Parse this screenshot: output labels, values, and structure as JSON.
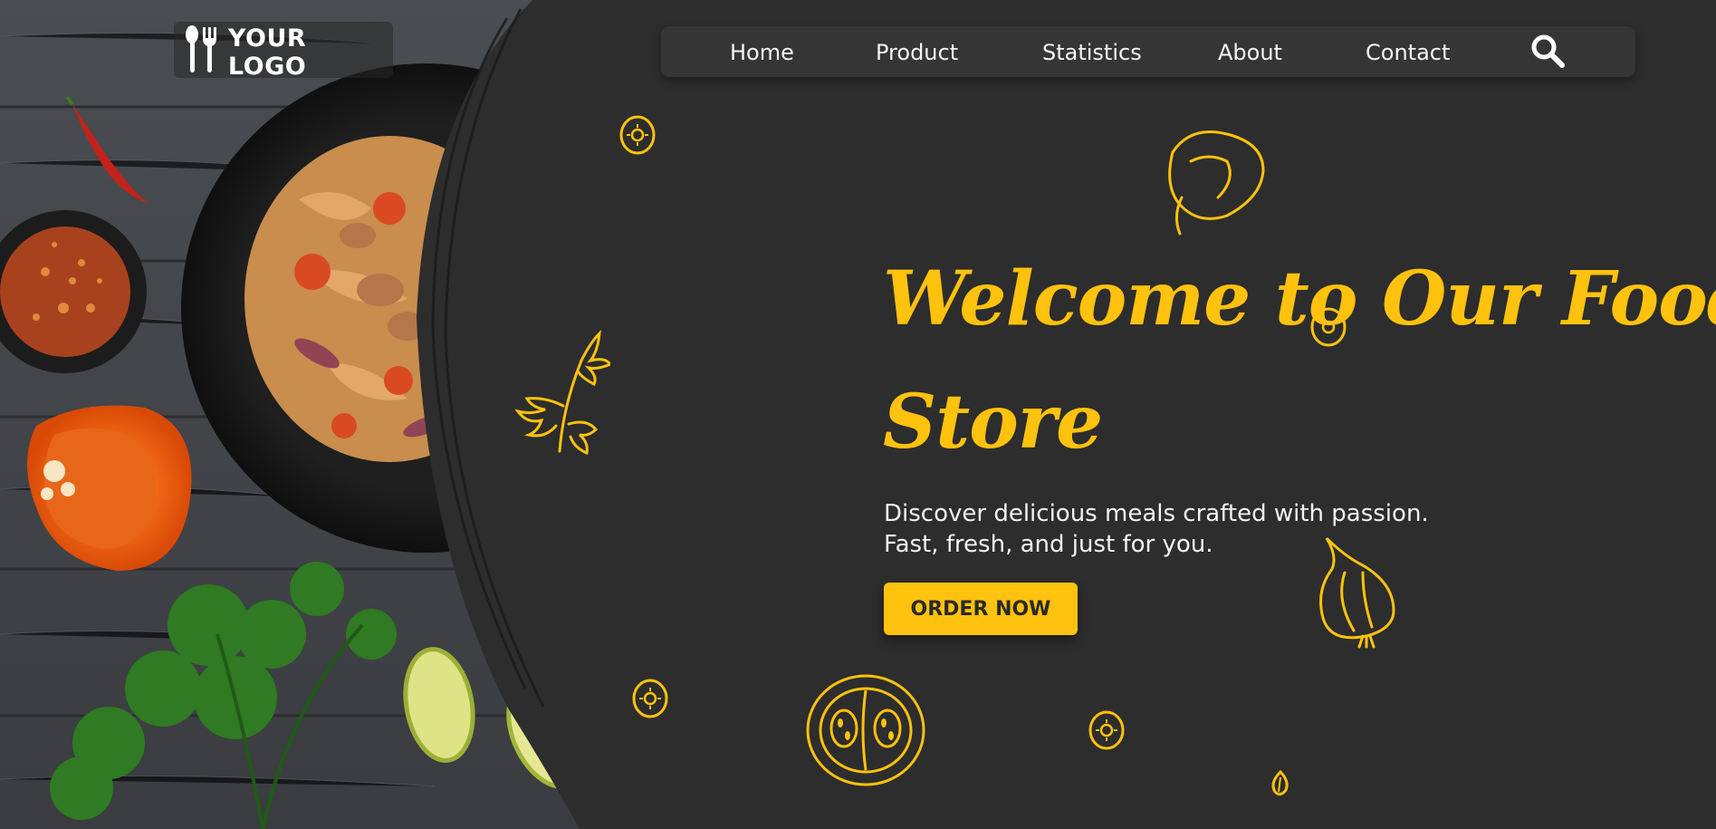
{
  "brand": {
    "logo_text": "YOUR LOGO",
    "logo_icon": "fork-and-spoon-icon"
  },
  "nav": {
    "items": [
      {
        "label": "Home"
      },
      {
        "label": "Product"
      },
      {
        "label": "Statistics"
      },
      {
        "label": "About"
      },
      {
        "label": "Contact"
      }
    ],
    "search_icon": "search-icon"
  },
  "hero": {
    "title_line1": "Welcome to Our Food",
    "title_line2": "Store",
    "subtitle_line1": "Discover delicious meals crafted with passion.",
    "subtitle_line2": "Fast, fresh, and just for you.",
    "cta_label": "ORDER NOW"
  },
  "colors": {
    "background": "#2d2d2d",
    "accent": "#ffc20e",
    "nav_bg": "#353535",
    "text": "#f2f2f2"
  }
}
